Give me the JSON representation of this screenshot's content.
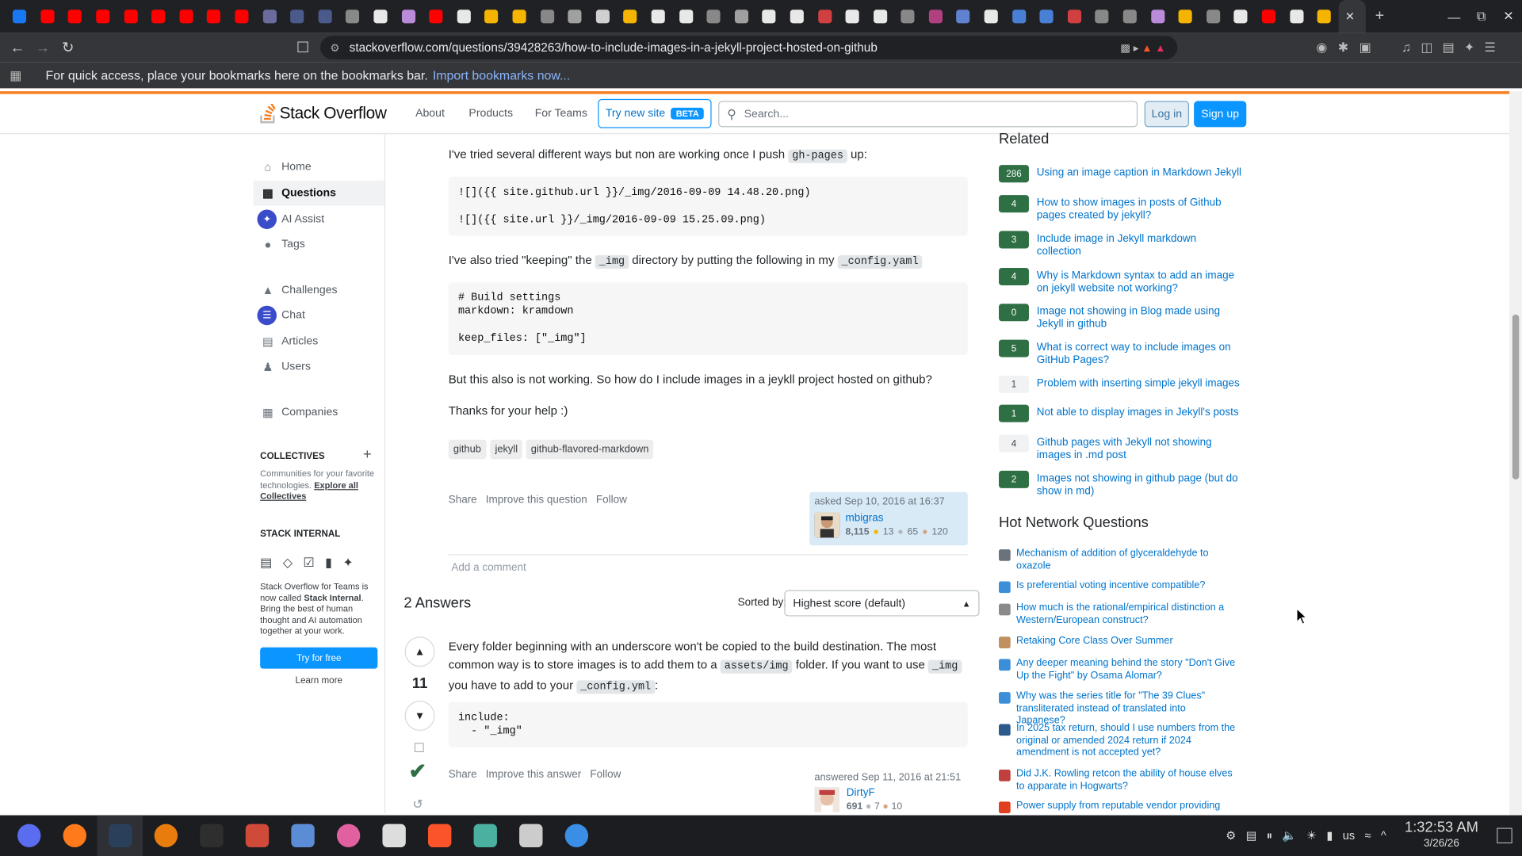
{
  "browser": {
    "url": "stackoverflow.com/questions/39428263/how-to-include-images-in-a-jekyll-project-hosted-on-github",
    "bookmarks_msg": "For quick access, place your bookmarks here on the bookmarks bar.",
    "bookmarks_link": "Import bookmarks now...",
    "tab_colors": [
      "#1877f2",
      "#ff0000",
      "#ff0000",
      "#ff0000",
      "#ff0000",
      "#ff0000",
      "#ff0000",
      "#ff0000",
      "#ff0000",
      "#6b6b9e",
      "#4a5a8a",
      "#4a5a8a",
      "#888888",
      "#e8e8e8",
      "#b98bd8",
      "#ff0000",
      "#e8e8e8",
      "#f5b400",
      "#f5b400",
      "#888888",
      "#a0a0a0",
      "#d0d0d0",
      "#f5b400",
      "#e8e8e8",
      "#e8e8e8",
      "#888888",
      "#a0a0a0",
      "#e8e8e8",
      "#e8e8e8",
      "#d04040",
      "#e8e8e8",
      "#e8e8e8",
      "#888888",
      "#b04080",
      "#6080d0",
      "#e8e8e8",
      "#4a7fd6",
      "#4a7fd6",
      "#d04040",
      "#888888",
      "#888888",
      "#b98bd8",
      "#f5b400",
      "#888888",
      "#e8e8e8",
      "#ff0000",
      "#e8e8e8",
      "#f5b400",
      "#e8e8e8"
    ]
  },
  "so_header": {
    "logo": "Stack Overflow",
    "nav_about": "About",
    "nav_products": "Products",
    "nav_teams": "For Teams",
    "try_new": "Try new site",
    "beta": "BETA",
    "search_placeholder": "Search...",
    "login": "Log in",
    "signup": "Sign up"
  },
  "sidebar": {
    "home": "Home",
    "questions": "Questions",
    "ai_assist": "AI Assist",
    "tags": "Tags",
    "challenges": "Challenges",
    "chat": "Chat",
    "articles": "Articles",
    "users": "Users",
    "companies": "Companies",
    "collectives_title": "COLLECTIVES",
    "collectives_desc": "Communities for your favorite technologies.",
    "collectives_link": "Explore all Collectives",
    "internal_title": "STACK INTERNAL",
    "internal_desc_1": "Stack Overflow for Teams is now called",
    "internal_desc_bold": "Stack Internal",
    "internal_desc_2": ". Bring the best of human thought and AI automation together at your work.",
    "try_free": "Try for free",
    "learn_more": "Learn more"
  },
  "question": {
    "p1_a": "I've tried several different ways but non are working once I push",
    "p1_code": "gh-pages",
    "p1_b": "up:",
    "code1_line1": "![]({{ site.github.url }}/_img/2016-09-09 14.48.20.png)",
    "code1_line2": "![]({{ site.url }}/_img/2016-09-09 15.25.09.png)",
    "p2_a": "I've also tried \"keeping\" the",
    "p2_code1": "_img",
    "p2_b": "directory by putting the following in my",
    "p2_code2": "_config.yaml",
    "code2": "# Build settings\nmarkdown: kramdown\n\nkeep_files: [\"_img\"]",
    "p3": "But this also is not working. So how do I include images in a jeykll project hosted on github?",
    "p4": "Thanks for your help :)",
    "tags": [
      "github",
      "jekyll",
      "github-flavored-markdown"
    ],
    "share": "Share",
    "improve": "Improve this question",
    "follow": "Follow",
    "asked": "asked Sep 10, 2016 at 16:37",
    "user": "mbigras",
    "rep": "8,115",
    "gold": "13",
    "silver": "65",
    "bronze": "120",
    "add_comment": "Add a comment"
  },
  "answers": {
    "count": "2 Answers",
    "sorted_by": "Sorted by:",
    "sort_value": "Highest score (default)",
    "a1_score": "11",
    "a1_p1_a": "Every folder beginning with an underscore won't be copied to the build destination. The most common way is to store images is to add them to a",
    "a1_code1": "assets/img",
    "a1_p1_b": "folder. If you want to use",
    "a1_code2": "_img",
    "a1_p1_c": "you have to add to your",
    "a1_code3": "_config.yml",
    "a1_p1_d": ":",
    "a1_code": "include:\n  - \"_img\"",
    "share": "Share",
    "improve": "Improve this answer",
    "follow": "Follow",
    "answered": "answered Sep 11, 2016 at 21:51",
    "user": "DirtyF",
    "rep": "691",
    "silver": "7",
    "bronze": "10"
  },
  "related": {
    "title": "Related",
    "items": [
      {
        "score": "286",
        "title": "Using an image caption in Markdown Jekyll"
      },
      {
        "score": "4",
        "title": "How to show images in posts of Github pages created by jekyll?"
      },
      {
        "score": "3",
        "title": "Include image in Jekyll markdown collection"
      },
      {
        "score": "4",
        "title": "Why is Markdown syntax to add an image on jekyll website not working?"
      },
      {
        "score": "0",
        "title": "Image not showing in Blog made using Jekyll in github"
      },
      {
        "score": "5",
        "title": "What is correct way to include images on GitHub Pages?"
      },
      {
        "score": "1",
        "title": "Problem with inserting simple jekyll images"
      },
      {
        "score": "1",
        "title": "Not able to display images in Jekyll's posts"
      },
      {
        "score": "4",
        "title": "Github pages with Jekyll not showing images in .md post"
      },
      {
        "score": "2",
        "title": "Images not showing in github page (but do show in md)"
      }
    ]
  },
  "hot": {
    "title": "Hot Network Questions",
    "items": [
      {
        "color": "#6a737c",
        "title": "Mechanism of addition of glyceraldehyde to oxazole"
      },
      {
        "color": "#3b8fd9",
        "title": "Is preferential voting incentive compatible?"
      },
      {
        "color": "#8a8a8a",
        "title": "How much is the rational/empirical distinction a Western/European construct?"
      },
      {
        "color": "#c09060",
        "title": "Retaking Core Class Over Summer"
      },
      {
        "color": "#3b8fd9",
        "title": "Any deeper meaning behind the story \"Don't Give Up the Fight\" by Osama Alomar?"
      },
      {
        "color": "#3b8fd9",
        "title": "Why was the series title for \"The 39 Clues\" transliterated instead of translated into Japanese?"
      },
      {
        "color": "#2c5a8a",
        "title": "In 2025 tax return, should I use numbers from the original or amended 2024 return if 2024 amendment is not accepted yet?"
      },
      {
        "color": "#c04040",
        "title": "Did J.K. Rowling retcon the ability of house elves to apparate in Hogwarts?"
      },
      {
        "color": "#e04020",
        "title": "Power supply from reputable vendor providing"
      }
    ]
  },
  "taskbar": {
    "apps": [
      {
        "name": "app-launcher-icon",
        "color": "#5a6cf0"
      },
      {
        "name": "firefox-icon",
        "color": "#ff7a1a"
      },
      {
        "name": "steam-icon",
        "color": "#2a3f5a"
      },
      {
        "name": "blender-icon",
        "color": "#e87d0d"
      },
      {
        "name": "terminal-icon",
        "color": "#2e2e2e"
      },
      {
        "name": "archive-manager-icon",
        "color": "#d04a3a"
      },
      {
        "name": "file-manager-icon",
        "color": "#5b8dd6"
      },
      {
        "name": "media-app-icon",
        "color": "#e060a0"
      },
      {
        "name": "text-editor-icon",
        "color": "#dddddd"
      },
      {
        "name": "brave-icon",
        "color": "#fb542b"
      },
      {
        "name": "screenshot-app-icon",
        "color": "#4ab0a0"
      },
      {
        "name": "zipper-app-icon",
        "color": "#cccccc"
      },
      {
        "name": "browser-app-icon",
        "color": "#3a8ee6"
      }
    ],
    "lang": "us",
    "time": "1:32:53 AM",
    "date": "3/26/26"
  }
}
